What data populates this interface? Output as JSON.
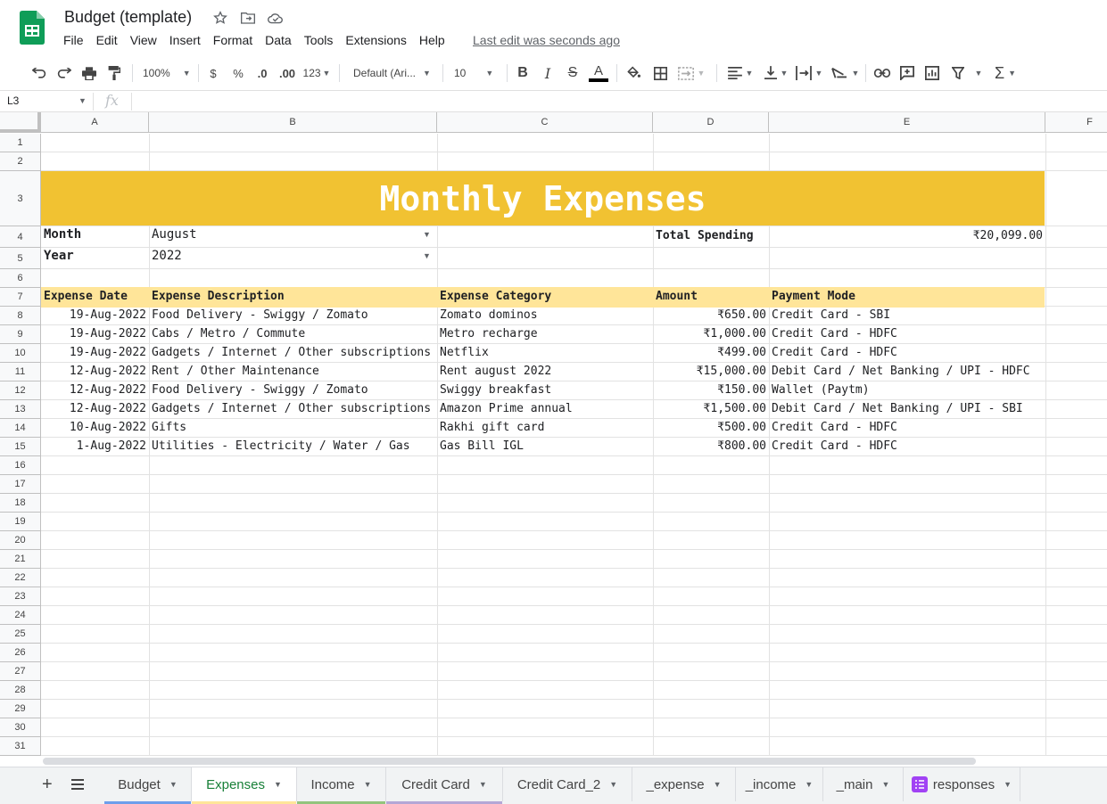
{
  "app": {
    "title": "Budget (template)",
    "menu": [
      "File",
      "Edit",
      "View",
      "Insert",
      "Format",
      "Data",
      "Tools",
      "Extensions",
      "Help"
    ],
    "last_edit": "Last edit was seconds ago"
  },
  "toolbar": {
    "zoom": "100%",
    "currency": "$",
    "percent": "%",
    "dec_decrease": ".0",
    "dec_increase": ".00",
    "more_formats": "123",
    "font": "Default (Ari...",
    "font_size": "10",
    "bold": "B",
    "italic": "I",
    "strike": "S",
    "text_color": "A"
  },
  "formula_bar": {
    "cell_ref": "L3",
    "fx": "fx",
    "value": ""
  },
  "columns": [
    "A",
    "B",
    "C",
    "D",
    "E",
    "F"
  ],
  "rows": [
    "1",
    "2",
    "3",
    "4",
    "5",
    "6",
    "7",
    "8",
    "9",
    "10",
    "11",
    "12",
    "13",
    "14",
    "15",
    "16",
    "17",
    "18",
    "19",
    "20",
    "21",
    "22",
    "23",
    "24",
    "25",
    "26",
    "27",
    "28",
    "29",
    "30",
    "31"
  ],
  "sheet": {
    "banner": "Monthly Expenses",
    "month_label": "Month",
    "month_value": "August",
    "year_label": "Year",
    "year_value": "2022",
    "total_label": "Total Spending",
    "total_value": "₹20,099.00",
    "headers": {
      "date": "Expense Date",
      "description": "Expense Description",
      "category": "Expense Category",
      "amount": "Amount",
      "mode": "Payment Mode"
    },
    "expenses": [
      {
        "date": "19-Aug-2022",
        "description": "Food Delivery - Swiggy / Zomato",
        "category": "Zomato dominos",
        "amount": "₹650.00",
        "mode": "Credit Card - SBI"
      },
      {
        "date": "19-Aug-2022",
        "description": "Cabs / Metro / Commute",
        "category": "Metro recharge",
        "amount": "₹1,000.00",
        "mode": "Credit Card - HDFC"
      },
      {
        "date": "19-Aug-2022",
        "description": "Gadgets / Internet / Other subscriptions",
        "category": "Netflix",
        "amount": "₹499.00",
        "mode": "Credit Card - HDFC"
      },
      {
        "date": "12-Aug-2022",
        "description": "Rent / Other Maintenance",
        "category": "Rent august 2022",
        "amount": "₹15,000.00",
        "mode": "Debit Card / Net Banking / UPI - HDFC"
      },
      {
        "date": "12-Aug-2022",
        "description": "Food Delivery - Swiggy / Zomato",
        "category": "Swiggy breakfast",
        "amount": "₹150.00",
        "mode": "Wallet (Paytm)"
      },
      {
        "date": "12-Aug-2022",
        "description": "Gadgets / Internet / Other subscriptions",
        "category": "Amazon Prime annual",
        "amount": "₹1,500.00",
        "mode": "Debit Card / Net Banking / UPI - SBI"
      },
      {
        "date": "10-Aug-2022",
        "description": "Gifts",
        "category": "Rakhi gift card",
        "amount": "₹500.00",
        "mode": "Credit Card - HDFC"
      },
      {
        "date": "1-Aug-2022",
        "description": "Utilities - Electricity / Water / Gas",
        "category": "Gas Bill IGL",
        "amount": "₹800.00",
        "mode": "Credit Card - HDFC"
      }
    ]
  },
  "tabs": [
    {
      "label": "Budget",
      "color": "#6d9eeb",
      "active": false
    },
    {
      "label": "Expenses",
      "color": "#ffe599",
      "active": true
    },
    {
      "label": "Income",
      "color": "#93c47d",
      "active": false
    },
    {
      "label": "Credit Card",
      "color": "#b4a7d6",
      "active": false
    },
    {
      "label": "Credit Card_2",
      "color": "",
      "active": false
    },
    {
      "label": "_expense",
      "color": "",
      "active": false
    },
    {
      "label": "_income",
      "color": "",
      "active": false
    },
    {
      "label": "_main",
      "color": "",
      "active": false
    },
    {
      "label": "responses",
      "color": "",
      "active": false,
      "icon": "form-icon"
    }
  ],
  "colors": {
    "banner": "#f1c232",
    "header_row": "#ffe599",
    "sheets_green": "#0f9d58",
    "active_tab_text": "#188038"
  }
}
